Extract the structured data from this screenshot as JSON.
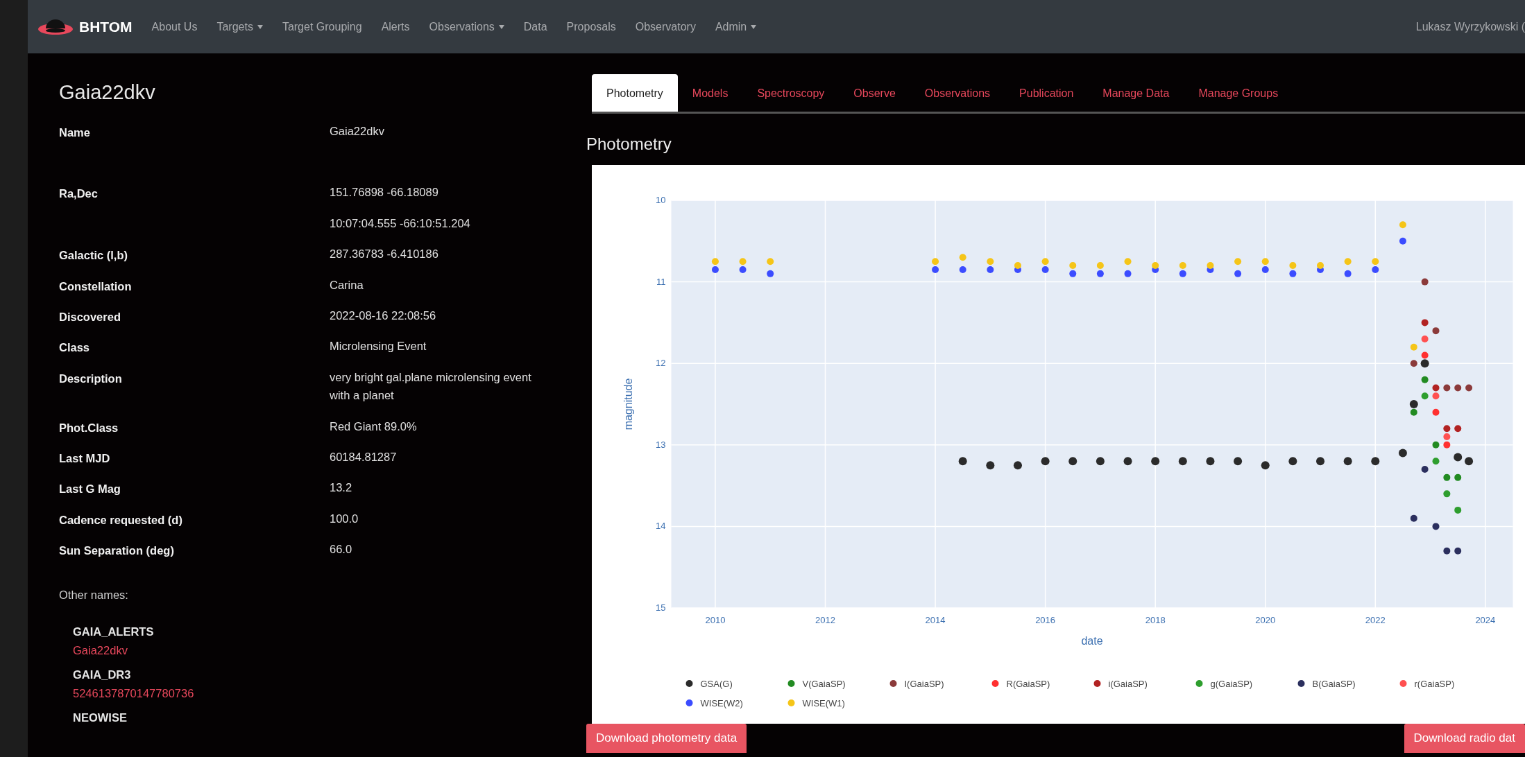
{
  "navbar": {
    "brand": "BHTOM",
    "items": [
      {
        "label": "About Us",
        "dropdown": false
      },
      {
        "label": "Targets",
        "dropdown": true
      },
      {
        "label": "Target Grouping",
        "dropdown": false
      },
      {
        "label": "Alerts",
        "dropdown": false
      },
      {
        "label": "Observations",
        "dropdown": true
      },
      {
        "label": "Data",
        "dropdown": false
      },
      {
        "label": "Proposals",
        "dropdown": false
      },
      {
        "label": "Observatory",
        "dropdown": false
      },
      {
        "label": "Admin",
        "dropdown": true
      }
    ],
    "user": "Lukasz Wyrzykowski ("
  },
  "target": {
    "title": "Gaia22dkv",
    "fields": [
      {
        "label": "Name",
        "values": [
          "Gaia22dkv"
        ]
      },
      {
        "label": "Ra,Dec",
        "values": [
          "151.76898 -66.18089",
          "10:07:04.555 -66:10:51.204"
        ]
      },
      {
        "label": "Galactic (l,b)",
        "values": [
          "287.36783 -6.410186"
        ]
      },
      {
        "label": "Constellation",
        "values": [
          "Carina"
        ]
      },
      {
        "label": "Discovered",
        "values": [
          "2022-08-16 22:08:56"
        ]
      },
      {
        "label": "Class",
        "values": [
          "Microlensing Event"
        ]
      },
      {
        "label": "Description",
        "values": [
          "very bright gal.plane microlensing event with a planet"
        ]
      },
      {
        "label": "Phot.Class",
        "values": [
          "Red Giant 89.0%"
        ]
      },
      {
        "label": "Last MJD",
        "values": [
          "60184.81287"
        ]
      },
      {
        "label": "Last G Mag",
        "values": [
          "13.2"
        ]
      },
      {
        "label": "Cadence requested (d)",
        "values": [
          "100.0"
        ]
      },
      {
        "label": "Sun Separation (deg)",
        "values": [
          "66.0"
        ]
      }
    ],
    "other_names_heading": "Other names:",
    "other_names": [
      {
        "catalog": "GAIA_ALERTS",
        "name": "Gaia22dkv"
      },
      {
        "catalog": "GAIA_DR3",
        "name": "5246137870147780736"
      },
      {
        "catalog": "NEOWISE"
      }
    ]
  },
  "tabs": [
    {
      "label": "Photometry",
      "selected": true
    },
    {
      "label": "Models",
      "selected": false
    },
    {
      "label": "Spectroscopy",
      "selected": false
    },
    {
      "label": "Observe",
      "selected": false
    },
    {
      "label": "Observations",
      "selected": false
    },
    {
      "label": "Publication",
      "selected": false
    },
    {
      "label": "Manage Data",
      "selected": false
    },
    {
      "label": "Manage Groups",
      "selected": false
    }
  ],
  "section_title": "Photometry",
  "chart_data": {
    "type": "scatter",
    "grid": true,
    "legend": "bottom",
    "xlabel": "date",
    "ylabel": "magnitude",
    "x": [
      2010.0,
      2010.5,
      2011.0,
      2014.0,
      2014.5,
      2015.0,
      2015.5,
      2016.0,
      2016.5,
      2017.0,
      2017.5,
      2018.0,
      2018.5,
      2019.0,
      2019.5,
      2020.0,
      2020.5,
      2021.0,
      2021.5,
      2022.0,
      2022.5,
      2022.7,
      2022.9,
      2023.1,
      2023.3,
      2023.5,
      2023.7
    ],
    "xlim": [
      2009.2,
      2024.5
    ],
    "ylim": [
      15,
      10
    ],
    "xticks": [
      2010,
      2012,
      2014,
      2016,
      2018,
      2020,
      2022,
      2024
    ],
    "yticks": [
      10,
      11,
      12,
      13,
      14,
      15
    ],
    "series": [
      {
        "name": "GSA(G)",
        "color": "#2b2b2b",
        "values": [
          null,
          null,
          null,
          null,
          13.2,
          13.25,
          13.25,
          13.2,
          13.2,
          13.2,
          13.2,
          13.2,
          13.2,
          13.2,
          13.2,
          13.25,
          13.2,
          13.2,
          13.2,
          13.2,
          13.1,
          12.5,
          12.0,
          null,
          null,
          13.15,
          13.2
        ]
      },
      {
        "name": "V(GaiaSP)",
        "color": "#228b22",
        "values": [
          null,
          null,
          null,
          null,
          null,
          null,
          null,
          null,
          null,
          null,
          null,
          null,
          null,
          null,
          null,
          null,
          null,
          null,
          null,
          null,
          null,
          12.6,
          12.2,
          13.0,
          13.4,
          13.4,
          null
        ]
      },
      {
        "name": "I(GaiaSP)",
        "color": "#8b3a3a",
        "values": [
          null,
          null,
          null,
          null,
          null,
          null,
          null,
          null,
          null,
          null,
          null,
          null,
          null,
          null,
          null,
          null,
          null,
          null,
          null,
          null,
          null,
          12.0,
          11.0,
          11.6,
          12.3,
          12.3,
          12.3
        ]
      },
      {
        "name": "R(GaiaSP)",
        "color": "#ff3030",
        "values": [
          null,
          null,
          null,
          null,
          null,
          null,
          null,
          null,
          null,
          null,
          null,
          null,
          null,
          null,
          null,
          null,
          null,
          null,
          null,
          null,
          null,
          null,
          11.9,
          12.6,
          13.0,
          null,
          null
        ]
      },
      {
        "name": "i(GaiaSP)",
        "color": "#b22222",
        "values": [
          null,
          null,
          null,
          null,
          null,
          null,
          null,
          null,
          null,
          null,
          null,
          null,
          null,
          null,
          null,
          null,
          null,
          null,
          null,
          null,
          null,
          null,
          11.5,
          12.3,
          12.8,
          12.8,
          null
        ]
      },
      {
        "name": "g(GaiaSP)",
        "color": "#2e9e2e",
        "values": [
          null,
          null,
          null,
          null,
          null,
          null,
          null,
          null,
          null,
          null,
          null,
          null,
          null,
          null,
          null,
          null,
          null,
          null,
          null,
          null,
          null,
          null,
          12.4,
          13.2,
          13.6,
          13.8,
          null
        ]
      },
      {
        "name": "B(GaiaSP)",
        "color": "#2b2f5e",
        "values": [
          null,
          null,
          null,
          null,
          null,
          null,
          null,
          null,
          null,
          null,
          null,
          null,
          null,
          null,
          null,
          null,
          null,
          null,
          null,
          null,
          null,
          13.9,
          13.3,
          14.0,
          14.3,
          14.3,
          null
        ]
      },
      {
        "name": "r(GaiaSP)",
        "color": "#ff5050",
        "values": [
          null,
          null,
          null,
          null,
          null,
          null,
          null,
          null,
          null,
          null,
          null,
          null,
          null,
          null,
          null,
          null,
          null,
          null,
          null,
          null,
          null,
          null,
          11.7,
          12.4,
          12.9,
          null,
          null
        ]
      },
      {
        "name": "WISE(W2)",
        "color": "#3b4cff",
        "values": [
          10.85,
          10.85,
          10.9,
          10.85,
          10.85,
          10.85,
          10.85,
          10.85,
          10.9,
          10.9,
          10.9,
          10.85,
          10.9,
          10.85,
          10.9,
          10.85,
          10.9,
          10.85,
          10.9,
          10.85,
          10.5,
          null,
          null,
          null,
          null,
          null,
          null
        ]
      },
      {
        "name": "WISE(W1)",
        "color": "#f5c518",
        "values": [
          10.75,
          10.75,
          10.75,
          10.75,
          10.7,
          10.75,
          10.8,
          10.75,
          10.8,
          10.8,
          10.75,
          10.8,
          10.8,
          10.8,
          10.75,
          10.75,
          10.8,
          10.8,
          10.75,
          10.75,
          10.3,
          11.8,
          null,
          null,
          null,
          null,
          null
        ]
      }
    ]
  },
  "buttons": [
    "Download photometry data",
    "Download radio dat"
  ]
}
